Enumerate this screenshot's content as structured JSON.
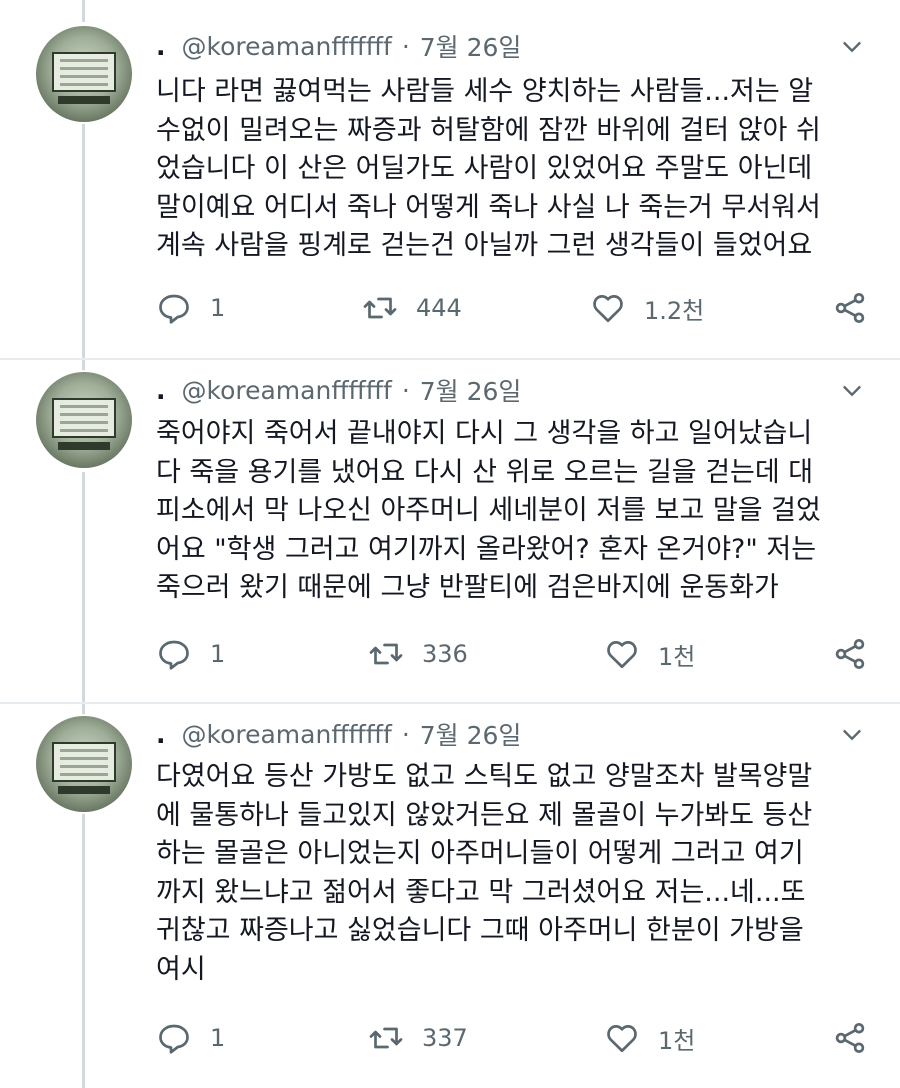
{
  "tweets": [
    {
      "dot": ".",
      "handle": "@koreamanfffffff",
      "sep": "·",
      "date": "7월 26일",
      "lines": [
        "니다 라면 끓여먹는 사람들 세수 양치하는 사람들...저는 알",
        "수없이 밀려오는 짜증과 허탈함에 잠깐 바위에 걸터 앉아 쉬",
        "었습니다 이 산은 어딜가도 사람이 있었어요 주말도 아닌데",
        "말이예요 어디서 죽나 어떻게 죽나 사실 나 죽는거 무서워서",
        "계속 사람을 핑계로 걷는건 아닐까 그런 생각들이 들었어요"
      ],
      "replies": "1",
      "retweets": "444",
      "likes": "1.2천"
    },
    {
      "dot": ".",
      "handle": "@koreamanfffffff",
      "sep": "·",
      "date": "7월 26일",
      "lines": [
        "죽어야지 죽어서 끝내야지 다시 그 생각을 하고 일어났습니",
        "다 죽을 용기를 냈어요 다시 산 위로 오르는 길을 걷는데 대",
        "피소에서 막 나오신 아주머니 세네분이 저를 보고 말을 걸었",
        "어요 \"학생 그러고 여기까지 올라왔어? 혼자 온거야?\" 저는",
        "죽으러 왔기 때문에 그냥 반팔티에 검은바지에 운동화가"
      ],
      "replies": "1",
      "retweets": "336",
      "likes": "1천"
    },
    {
      "dot": ".",
      "handle": "@koreamanfffffff",
      "sep": "·",
      "date": "7월 26일",
      "lines": [
        "다였어요 등산 가방도 없고 스틱도 없고 양말조차 발목양말",
        "에 물통하나 들고있지 않았거든요 제 몰골이 누가봐도 등산",
        "하는 몰골은 아니었는지 아주머니들이 어떻게 그러고 여기",
        "까지 왔느냐고 젊어서 좋다고 막 그러셨어요 저는...네...또",
        "귀찮고 짜증나고 싫었습니다 그때 아주머니 한분이 가방을",
        "여시"
      ],
      "replies": "1",
      "retweets": "337",
      "likes": "1천"
    }
  ],
  "icons": {
    "reply": "reply-icon",
    "retweet": "retweet-icon",
    "like": "like-icon",
    "share": "share-icon",
    "more": "chevron-down-icon"
  },
  "colors": {
    "text": "#141823",
    "muted": "#5b6870",
    "thread_line": "#cfd9de"
  }
}
